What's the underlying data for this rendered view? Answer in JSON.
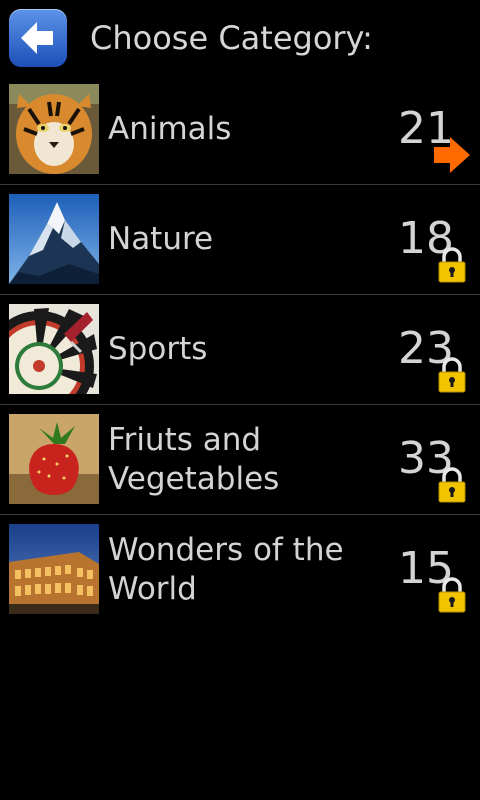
{
  "header": {
    "title": "Choose Category:",
    "back_icon": "left-arrow-icon"
  },
  "colors": {
    "background": "#000000",
    "accent_arrow": "#ff6a00",
    "lock": "#f2c400",
    "back_button": "#2f66d0"
  },
  "categories": [
    {
      "label": "Animals",
      "count": "21",
      "status_icon": "right-arrow-icon",
      "image": "tiger"
    },
    {
      "label": "Nature",
      "count": "18",
      "status_icon": "lock-icon",
      "image": "mountain"
    },
    {
      "label": "Sports",
      "count": "23",
      "status_icon": "lock-icon",
      "image": "dartboard"
    },
    {
      "label": "Friuts and Vegetables",
      "count": "33",
      "status_icon": "lock-icon",
      "image": "strawberry"
    },
    {
      "label": "Wonders of the World",
      "count": "15",
      "status_icon": "lock-icon",
      "image": "colosseum"
    }
  ]
}
